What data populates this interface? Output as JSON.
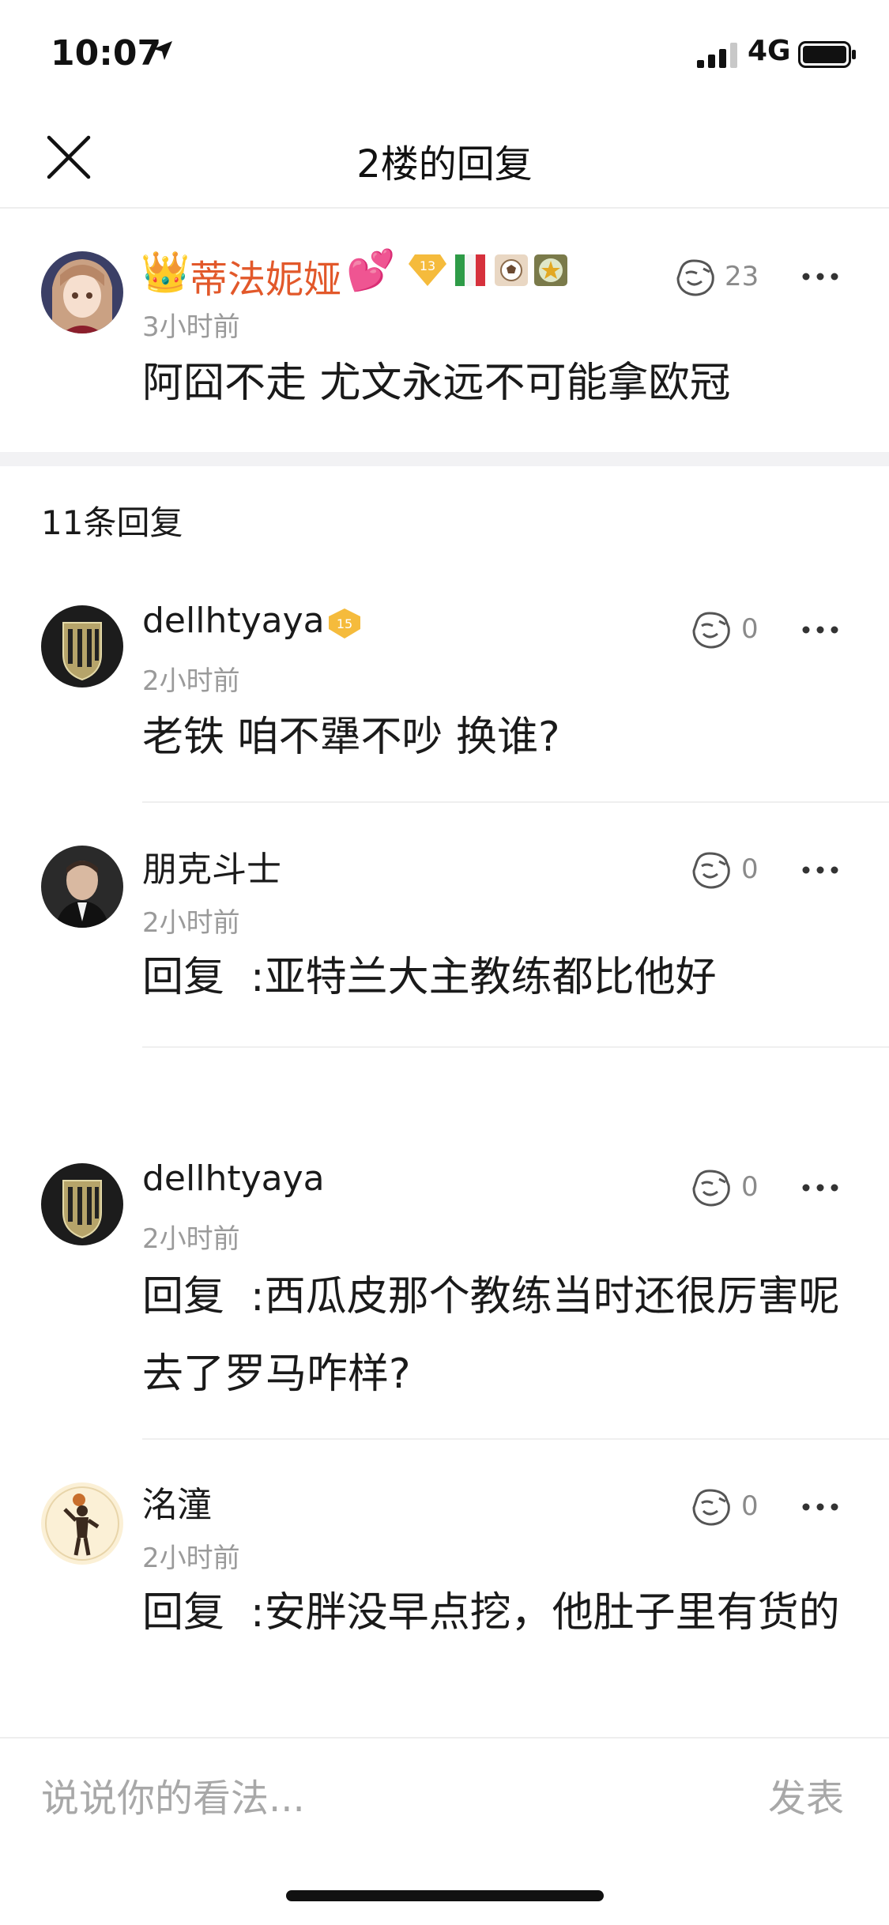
{
  "status_bar": {
    "time": "10:07",
    "network": "4G"
  },
  "nav": {
    "title": "2楼的回复"
  },
  "main_post": {
    "username": "蒂法妮娅",
    "time": "3小时前",
    "content": "阿囧不走 尤文永远不可能拿欧冠",
    "likes": "23",
    "level_badge": "13"
  },
  "replies_header": "11条回复",
  "replies": [
    {
      "username": "dellhtyaya",
      "level_badge": "15",
      "time": "2小时前",
      "content": "老铁 咱不犟不吵 换谁?",
      "likes": "0"
    },
    {
      "username": "朋克斗士",
      "time": "2小时前",
      "content": "回复  :亚特兰大主教练都比他好",
      "likes": "0"
    },
    {
      "username": "dellhtyaya",
      "time": "2小时前",
      "content": "回复  :西瓜皮那个教练当时还很厉害呢 去了罗马咋样?",
      "likes": "0"
    },
    {
      "username": "洺潼",
      "time": "2小时前",
      "content": "回复  :安胖没早点挖，他肚子里有货的",
      "likes": "0"
    }
  ],
  "input_bar": {
    "placeholder": "说说你的看法...",
    "publish_label": "发表"
  }
}
